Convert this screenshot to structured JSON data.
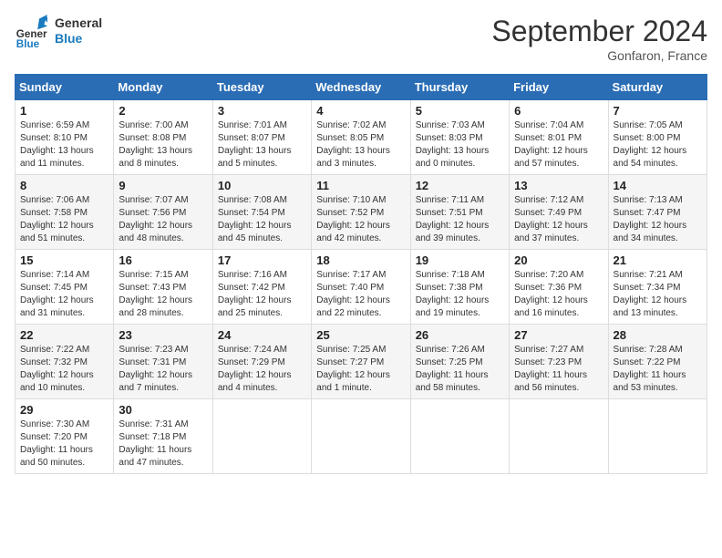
{
  "header": {
    "logo_line1": "General",
    "logo_line2": "Blue",
    "month_title": "September 2024",
    "location": "Gonfaron, France"
  },
  "days_of_week": [
    "Sunday",
    "Monday",
    "Tuesday",
    "Wednesday",
    "Thursday",
    "Friday",
    "Saturday"
  ],
  "weeks": [
    [
      {
        "day": "1",
        "sunrise": "6:59 AM",
        "sunset": "8:10 PM",
        "daylight": "13 hours and 11 minutes."
      },
      {
        "day": "2",
        "sunrise": "7:00 AM",
        "sunset": "8:08 PM",
        "daylight": "13 hours and 8 minutes."
      },
      {
        "day": "3",
        "sunrise": "7:01 AM",
        "sunset": "8:07 PM",
        "daylight": "13 hours and 5 minutes."
      },
      {
        "day": "4",
        "sunrise": "7:02 AM",
        "sunset": "8:05 PM",
        "daylight": "13 hours and 3 minutes."
      },
      {
        "day": "5",
        "sunrise": "7:03 AM",
        "sunset": "8:03 PM",
        "daylight": "13 hours and 0 minutes."
      },
      {
        "day": "6",
        "sunrise": "7:04 AM",
        "sunset": "8:01 PM",
        "daylight": "12 hours and 57 minutes."
      },
      {
        "day": "7",
        "sunrise": "7:05 AM",
        "sunset": "8:00 PM",
        "daylight": "12 hours and 54 minutes."
      }
    ],
    [
      {
        "day": "8",
        "sunrise": "7:06 AM",
        "sunset": "7:58 PM",
        "daylight": "12 hours and 51 minutes."
      },
      {
        "day": "9",
        "sunrise": "7:07 AM",
        "sunset": "7:56 PM",
        "daylight": "12 hours and 48 minutes."
      },
      {
        "day": "10",
        "sunrise": "7:08 AM",
        "sunset": "7:54 PM",
        "daylight": "12 hours and 45 minutes."
      },
      {
        "day": "11",
        "sunrise": "7:10 AM",
        "sunset": "7:52 PM",
        "daylight": "12 hours and 42 minutes."
      },
      {
        "day": "12",
        "sunrise": "7:11 AM",
        "sunset": "7:51 PM",
        "daylight": "12 hours and 39 minutes."
      },
      {
        "day": "13",
        "sunrise": "7:12 AM",
        "sunset": "7:49 PM",
        "daylight": "12 hours and 37 minutes."
      },
      {
        "day": "14",
        "sunrise": "7:13 AM",
        "sunset": "7:47 PM",
        "daylight": "12 hours and 34 minutes."
      }
    ],
    [
      {
        "day": "15",
        "sunrise": "7:14 AM",
        "sunset": "7:45 PM",
        "daylight": "12 hours and 31 minutes."
      },
      {
        "day": "16",
        "sunrise": "7:15 AM",
        "sunset": "7:43 PM",
        "daylight": "12 hours and 28 minutes."
      },
      {
        "day": "17",
        "sunrise": "7:16 AM",
        "sunset": "7:42 PM",
        "daylight": "12 hours and 25 minutes."
      },
      {
        "day": "18",
        "sunrise": "7:17 AM",
        "sunset": "7:40 PM",
        "daylight": "12 hours and 22 minutes."
      },
      {
        "day": "19",
        "sunrise": "7:18 AM",
        "sunset": "7:38 PM",
        "daylight": "12 hours and 19 minutes."
      },
      {
        "day": "20",
        "sunrise": "7:20 AM",
        "sunset": "7:36 PM",
        "daylight": "12 hours and 16 minutes."
      },
      {
        "day": "21",
        "sunrise": "7:21 AM",
        "sunset": "7:34 PM",
        "daylight": "12 hours and 13 minutes."
      }
    ],
    [
      {
        "day": "22",
        "sunrise": "7:22 AM",
        "sunset": "7:32 PM",
        "daylight": "12 hours and 10 minutes."
      },
      {
        "day": "23",
        "sunrise": "7:23 AM",
        "sunset": "7:31 PM",
        "daylight": "12 hours and 7 minutes."
      },
      {
        "day": "24",
        "sunrise": "7:24 AM",
        "sunset": "7:29 PM",
        "daylight": "12 hours and 4 minutes."
      },
      {
        "day": "25",
        "sunrise": "7:25 AM",
        "sunset": "7:27 PM",
        "daylight": "12 hours and 1 minute."
      },
      {
        "day": "26",
        "sunrise": "7:26 AM",
        "sunset": "7:25 PM",
        "daylight": "11 hours and 58 minutes."
      },
      {
        "day": "27",
        "sunrise": "7:27 AM",
        "sunset": "7:23 PM",
        "daylight": "11 hours and 56 minutes."
      },
      {
        "day": "28",
        "sunrise": "7:28 AM",
        "sunset": "7:22 PM",
        "daylight": "11 hours and 53 minutes."
      }
    ],
    [
      {
        "day": "29",
        "sunrise": "7:30 AM",
        "sunset": "7:20 PM",
        "daylight": "11 hours and 50 minutes."
      },
      {
        "day": "30",
        "sunrise": "7:31 AM",
        "sunset": "7:18 PM",
        "daylight": "11 hours and 47 minutes."
      },
      null,
      null,
      null,
      null,
      null
    ]
  ],
  "labels": {
    "sunrise": "Sunrise:",
    "sunset": "Sunset:",
    "daylight": "Daylight:"
  }
}
